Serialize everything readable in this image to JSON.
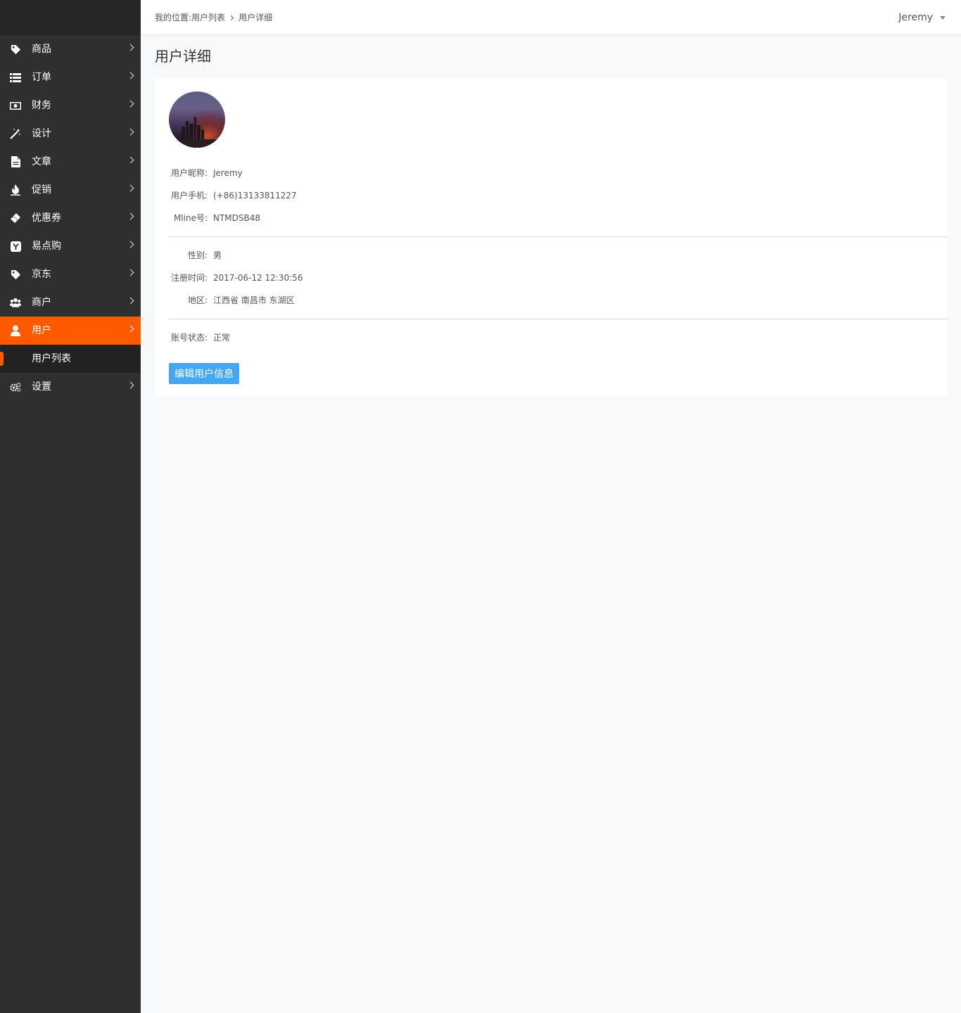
{
  "sidebar": {
    "items": [
      {
        "label": "商品",
        "icon": "tag-icon"
      },
      {
        "label": "订单",
        "icon": "list-icon"
      },
      {
        "label": "财务",
        "icon": "money-icon"
      },
      {
        "label": "设计",
        "icon": "magic-wand-icon"
      },
      {
        "label": "文章",
        "icon": "document-icon"
      },
      {
        "label": "促销",
        "icon": "fire-icon"
      },
      {
        "label": "优惠券",
        "icon": "ticket-icon"
      },
      {
        "label": "易点购",
        "icon": "y-badge-icon"
      },
      {
        "label": "京东",
        "icon": "tag-icon"
      },
      {
        "label": "商户",
        "icon": "users-icon"
      },
      {
        "label": "用户",
        "icon": "user-icon"
      },
      {
        "label": "设置",
        "icon": "gears-icon"
      }
    ],
    "sub_items": [
      {
        "label": "用户列表"
      }
    ]
  },
  "header": {
    "breadcrumb": {
      "prefix": "我的位置:",
      "level1": "用户列表",
      "level2": "用户详细"
    },
    "username": "Jeremy"
  },
  "page": {
    "title": "用户详细"
  },
  "user_detail": {
    "nickname_label": "用户昵称:",
    "nickname": "Jeremy",
    "phone_label": "用户手机:",
    "phone": "(+86)13133811227",
    "mline_label": "Mline号:",
    "mline": "NTMDSB48",
    "gender_label": "性别:",
    "gender": "男",
    "register_label": "注册时间:",
    "register_time": "2017-06-12 12:30:56",
    "region_label": "地区:",
    "region": "江西省 南昌市 东湖区",
    "status_label": "账号状态:",
    "status": "正常",
    "edit_button": "编辑用户信息"
  },
  "colors": {
    "accent": "#ff5a00",
    "sidebar_bg": "#2f2f2f",
    "button": "#44a7f0"
  }
}
